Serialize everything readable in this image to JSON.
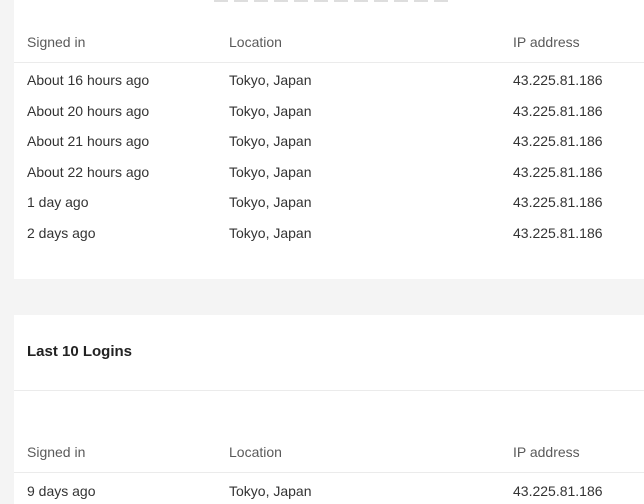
{
  "recent_logins": {
    "columns": [
      "Signed in",
      "Location",
      "IP address"
    ],
    "rows": [
      {
        "signed_in": "About 16 hours ago",
        "location": "Tokyo, Japan",
        "ip": "43.225.81.186"
      },
      {
        "signed_in": "About 20 hours ago",
        "location": "Tokyo, Japan",
        "ip": "43.225.81.186"
      },
      {
        "signed_in": "About 21 hours ago",
        "location": "Tokyo, Japan",
        "ip": "43.225.81.186"
      },
      {
        "signed_in": "About 22 hours ago",
        "location": "Tokyo, Japan",
        "ip": "43.225.81.186"
      },
      {
        "signed_in": "1 day ago",
        "location": "Tokyo, Japan",
        "ip": "43.225.81.186"
      },
      {
        "signed_in": "2 days ago",
        "location": "Tokyo, Japan",
        "ip": "43.225.81.186"
      }
    ]
  },
  "last_logins": {
    "title": "Last 10 Logins",
    "columns": [
      "Signed in",
      "Location",
      "IP address"
    ],
    "rows": [
      {
        "signed_in": "9 days ago",
        "location": "Tokyo, Japan",
        "ip": "43.225.81.186"
      }
    ]
  }
}
